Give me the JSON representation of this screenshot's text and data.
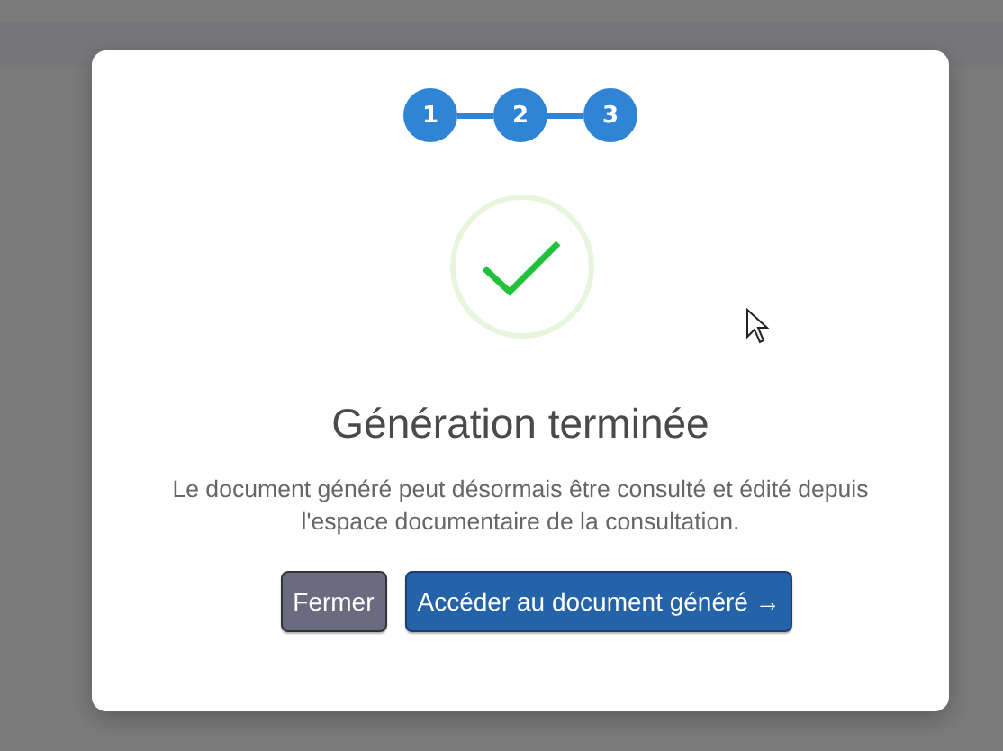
{
  "steps": [
    {
      "label": "1"
    },
    {
      "label": "2"
    },
    {
      "label": "3"
    }
  ],
  "dialog": {
    "title": "Génération terminée",
    "message": "Le document généré peut désormais être consulté et édité depuis l'espace documentaire de la consultation.",
    "buttons": [
      {
        "label": "Fermer",
        "kind": "secondary"
      },
      {
        "label": "Accéder au document généré →",
        "kind": "primary"
      }
    ]
  }
}
